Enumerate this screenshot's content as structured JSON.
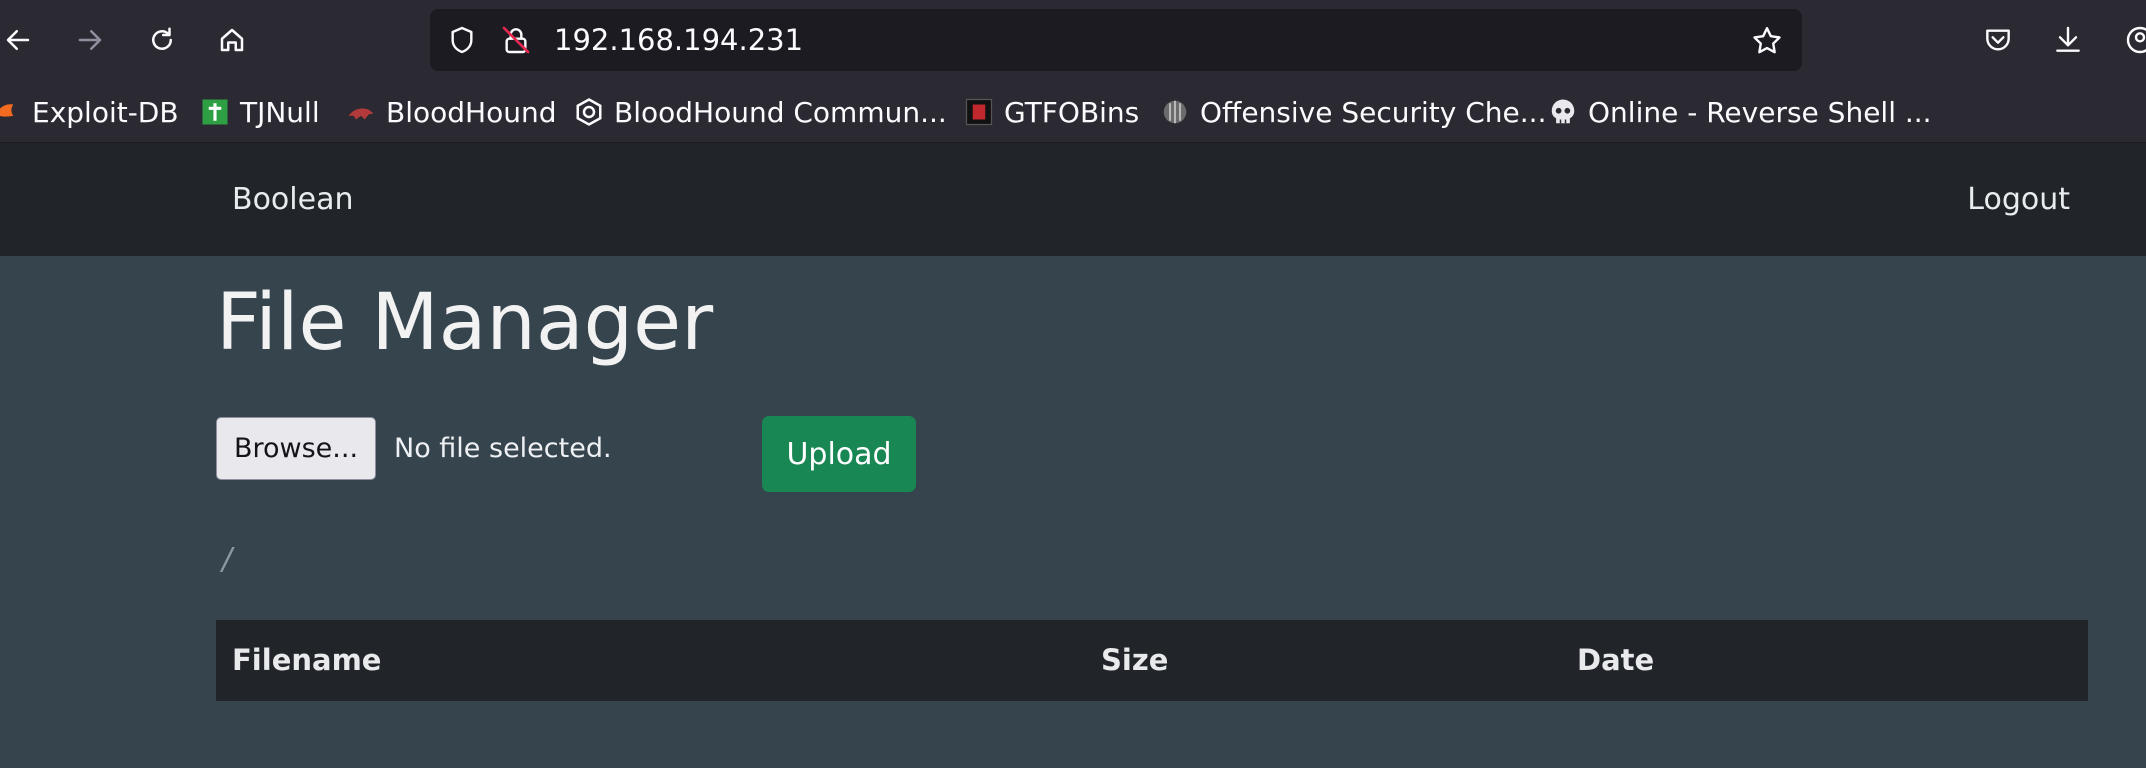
{
  "browser": {
    "url": "192.168.194.231",
    "icons": {
      "back": "arrow-left-icon",
      "forward": "arrow-right-icon",
      "reload": "reload-icon",
      "home": "home-icon",
      "tracking": "shield-icon",
      "connection": "insecure-lock-icon",
      "bookmark": "star-icon",
      "pocket": "pocket-icon",
      "downloads": "download-icon",
      "account": "account-icon"
    },
    "bookmarks": [
      {
        "label": "Exploit-DB",
        "icon": "exploit-db-icon"
      },
      {
        "label": "TJNull",
        "icon": "tjnull-icon"
      },
      {
        "label": "BloodHound",
        "icon": "bloodhound-icon"
      },
      {
        "label": "BloodHound Commun...",
        "icon": "bloodhound-community-icon"
      },
      {
        "label": "GTFOBins",
        "icon": "gtfobins-icon"
      },
      {
        "label": "Offensive Security Che...",
        "icon": "offsec-icon"
      },
      {
        "label": "Online - Reverse Shell ...",
        "icon": "skull-icon"
      }
    ]
  },
  "page": {
    "brand": "Boolean",
    "logout": "Logout",
    "title": "File Manager",
    "upload_form": {
      "browse_label": "Browse...",
      "file_status": "No file selected.",
      "upload_label": "Upload"
    },
    "current_path": "/",
    "table": {
      "columns": [
        "Filename",
        "Size",
        "Date"
      ],
      "rows": []
    }
  },
  "colors": {
    "browser_chrome": "#2b2a33",
    "urlbar": "#1c1b22",
    "navbar": "#212529",
    "page_background": "#36444d",
    "upload_button": "#198754"
  }
}
